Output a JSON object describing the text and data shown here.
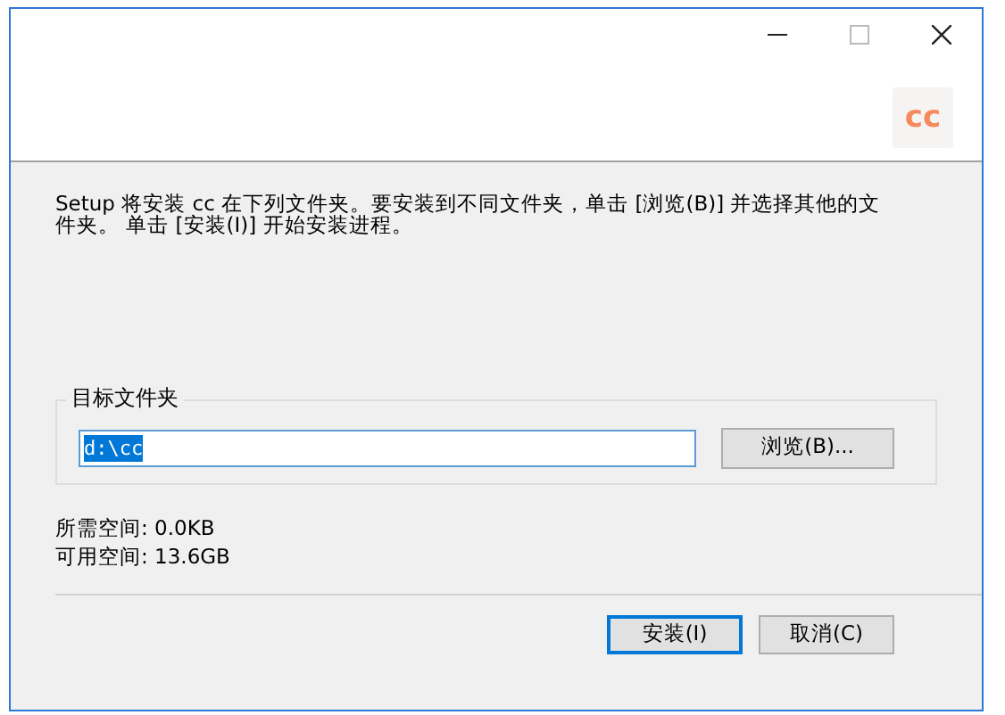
{
  "window": {
    "logo_text": "cc"
  },
  "description": "Setup 将安装 cc 在下列文件夹。要安装到不同文件夹，单击 [浏览(B)] 并选择其他的文件夹。 单击 [安装(I)] 开始安装进程。",
  "target_folder": {
    "label": "目标文件夹",
    "value": "d:\\cc",
    "value_selected": true,
    "browse_button": "浏览(B)..."
  },
  "space": [
    "所需空间: 0.0KB",
    "可用空间: 13.6GB"
  ],
  "buttons": [
    {
      "label": "安装(I)",
      "default": true
    },
    {
      "label": "取消(C)",
      "default": false
    }
  ]
}
